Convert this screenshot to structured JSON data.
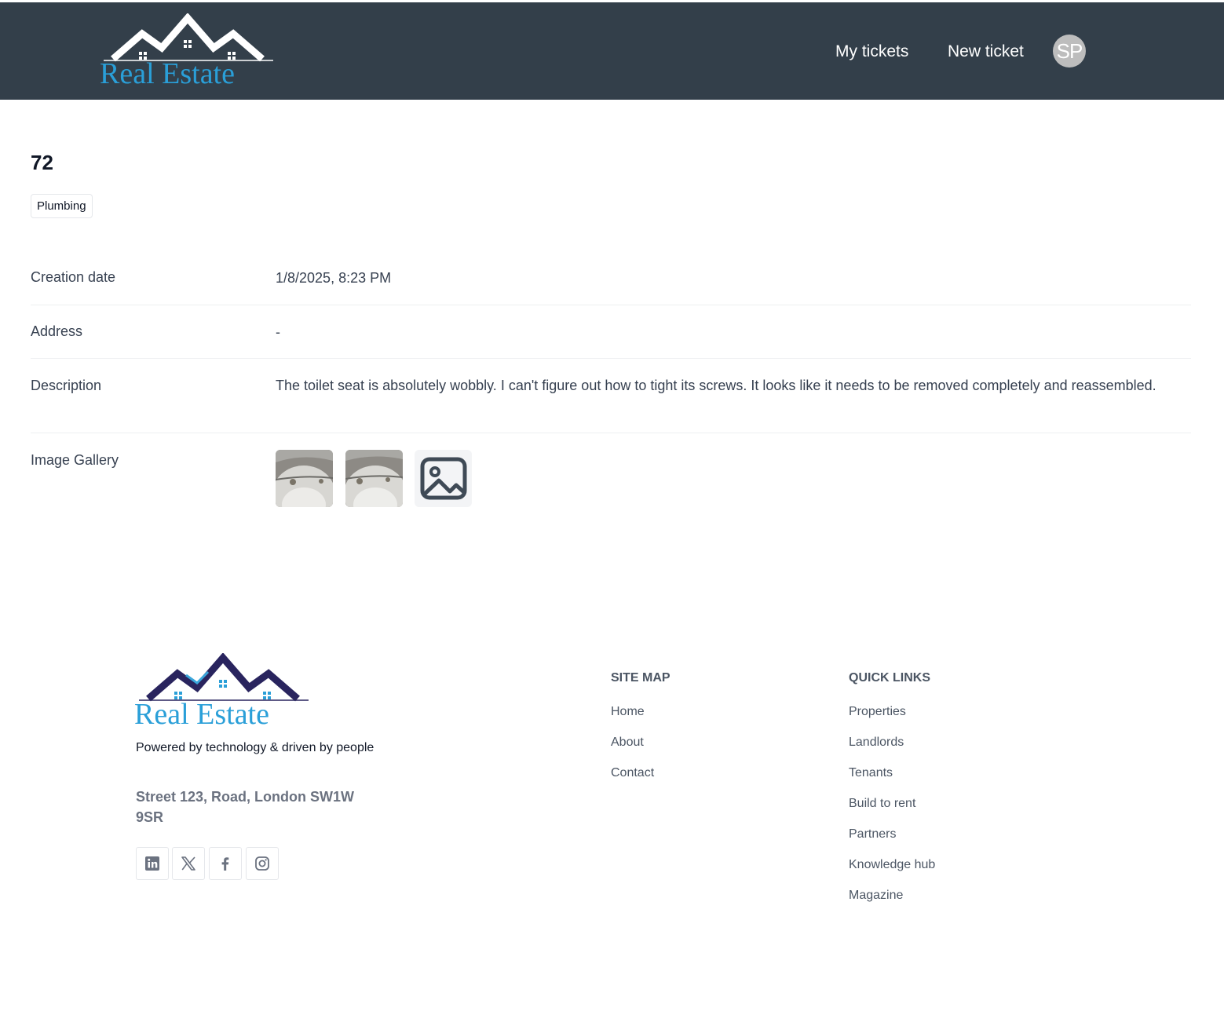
{
  "header": {
    "brand": "Real Estate",
    "nav": {
      "my_tickets": "My tickets",
      "new_ticket": "New ticket"
    },
    "avatar_initials": "SP",
    "colors": {
      "background": "#333f4a",
      "brand_text": "#2a9fd8"
    }
  },
  "ticket": {
    "id": "72",
    "category": "Plumbing",
    "fields": {
      "creation_date": {
        "label": "Creation date",
        "value": "1/8/2025, 8:23 PM"
      },
      "address": {
        "label": "Address",
        "value": "-"
      },
      "description": {
        "label": "Description",
        "value": "The toilet seat is absolutely wobbly. I can't figure out how to tight its screws. It looks like it needs to be removed completely and reassembled."
      },
      "gallery": {
        "label": "Image Gallery",
        "icons": [
          "photo-thumbnail",
          "photo-thumbnail",
          "image-placeholder-icon"
        ]
      }
    }
  },
  "footer": {
    "brand": "Real Estate",
    "tagline": "Powered by technology & driven by people",
    "address": "Street 123, Road, London SW1W 9SR",
    "social_icons": [
      "linkedin-icon",
      "x-icon",
      "facebook-icon",
      "instagram-icon"
    ],
    "site_map": {
      "title": "SITE MAP",
      "links": [
        "Home",
        "About",
        "Contact"
      ]
    },
    "quick_links": {
      "title": "QUICK LINKS",
      "links": [
        "Properties",
        "Landlords",
        "Tenants",
        "Build to rent",
        "Partners",
        "Knowledge hub",
        "Magazine"
      ]
    }
  }
}
